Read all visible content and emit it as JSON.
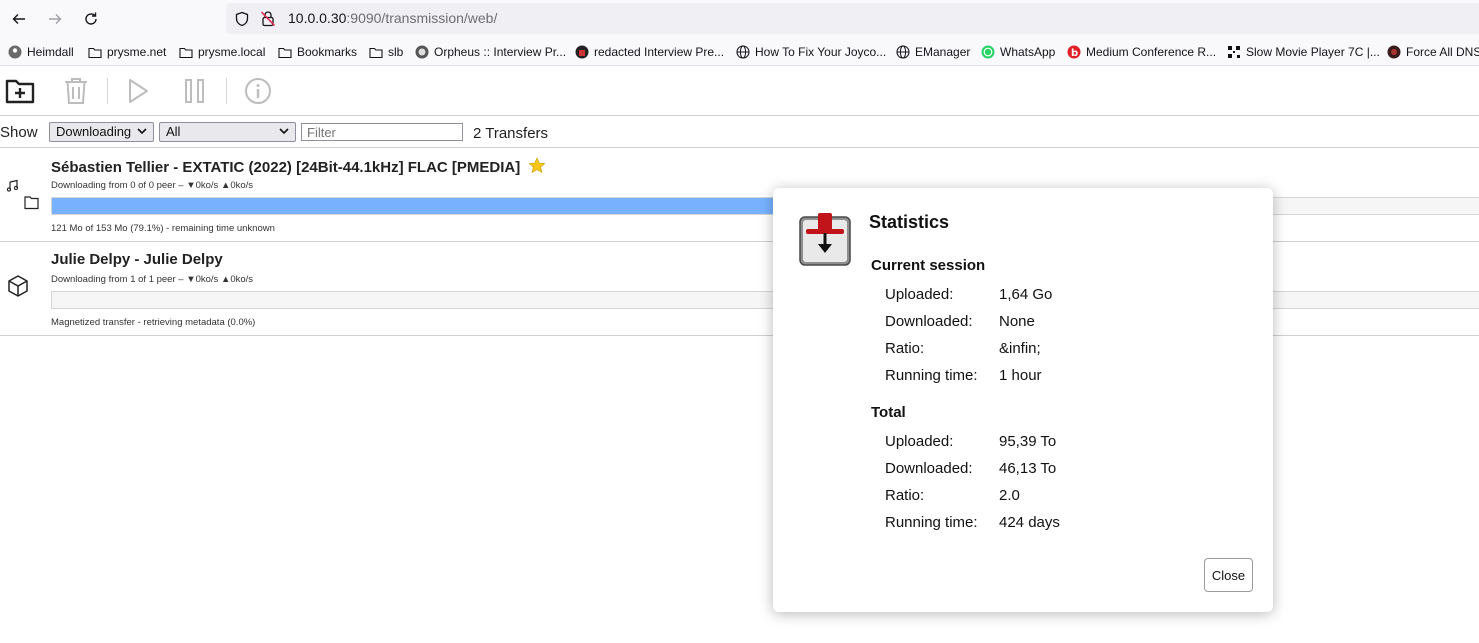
{
  "browser": {
    "url_host": "10.0.0.30",
    "url_rest": ":9090/transmission/web/",
    "bookmarks": [
      {
        "label": "Heimdall",
        "icon": "heimdall-icon"
      },
      {
        "label": "prysme.net",
        "icon": "folder-icon"
      },
      {
        "label": "prysme.local",
        "icon": "folder-icon"
      },
      {
        "label": "Bookmarks",
        "icon": "folder-icon"
      },
      {
        "label": "slb",
        "icon": "folder-icon"
      },
      {
        "label": "Orpheus :: Interview Pr...",
        "icon": "orpheus-icon"
      },
      {
        "label": "redacted Interview Pre...",
        "icon": "redacted-icon"
      },
      {
        "label": "How To Fix Your Joyco...",
        "icon": "globe-icon"
      },
      {
        "label": "EManager",
        "icon": "globe-icon"
      },
      {
        "label": "WhatsApp",
        "icon": "whatsapp-icon"
      },
      {
        "label": "Medium Conference R...",
        "icon": "beats-icon"
      },
      {
        "label": "Slow Movie Player 7C |...",
        "icon": "qr-icon"
      },
      {
        "label": "Force All DNS",
        "icon": "dns-icon"
      }
    ]
  },
  "filterbar": {
    "show_label": "Show",
    "state_filter": "Downloading",
    "tracker_filter": "All",
    "filter_placeholder": "Filter",
    "transfer_count": "2 Transfers"
  },
  "torrents": [
    {
      "name": "Sébastien Tellier - EXTATIC (2022) [24Bit-44.1kHz] FLAC [PMEDIA]",
      "peers": "Downloading from 0 of 0 peer – ▼0ko/s ▲0ko/s",
      "progress_text": "121 Mo of 153 Mo (79.1%) - remaining time unknown",
      "progress": 0.791,
      "starred": true
    },
    {
      "name": "Julie Delpy - Julie Delpy",
      "peers": "Downloading from 1 of 1 peer – ▼0ko/s ▲0ko/s",
      "progress_text": "Magnetized transfer - retrieving metadata (0.0%)",
      "progress": 0.0,
      "starred": false
    }
  ],
  "stats_dialog": {
    "title": "Statistics",
    "current_session": {
      "heading": "Current session",
      "rows": [
        {
          "label": "Uploaded:",
          "value": "1,64 Go"
        },
        {
          "label": "Downloaded:",
          "value": "None"
        },
        {
          "label": "Ratio:",
          "value": "&infin;"
        },
        {
          "label": "Running time:",
          "value": "1 hour"
        }
      ]
    },
    "total": {
      "heading": "Total",
      "rows": [
        {
          "label": "Uploaded:",
          "value": "95,39 To"
        },
        {
          "label": "Downloaded:",
          "value": "46,13 To"
        },
        {
          "label": "Ratio:",
          "value": "2.0"
        },
        {
          "label": "Running time:",
          "value": "424 days"
        }
      ]
    },
    "close_label": "Close"
  },
  "colors": {
    "progress_fill": "#78b2ff",
    "star": "#f5c518"
  }
}
